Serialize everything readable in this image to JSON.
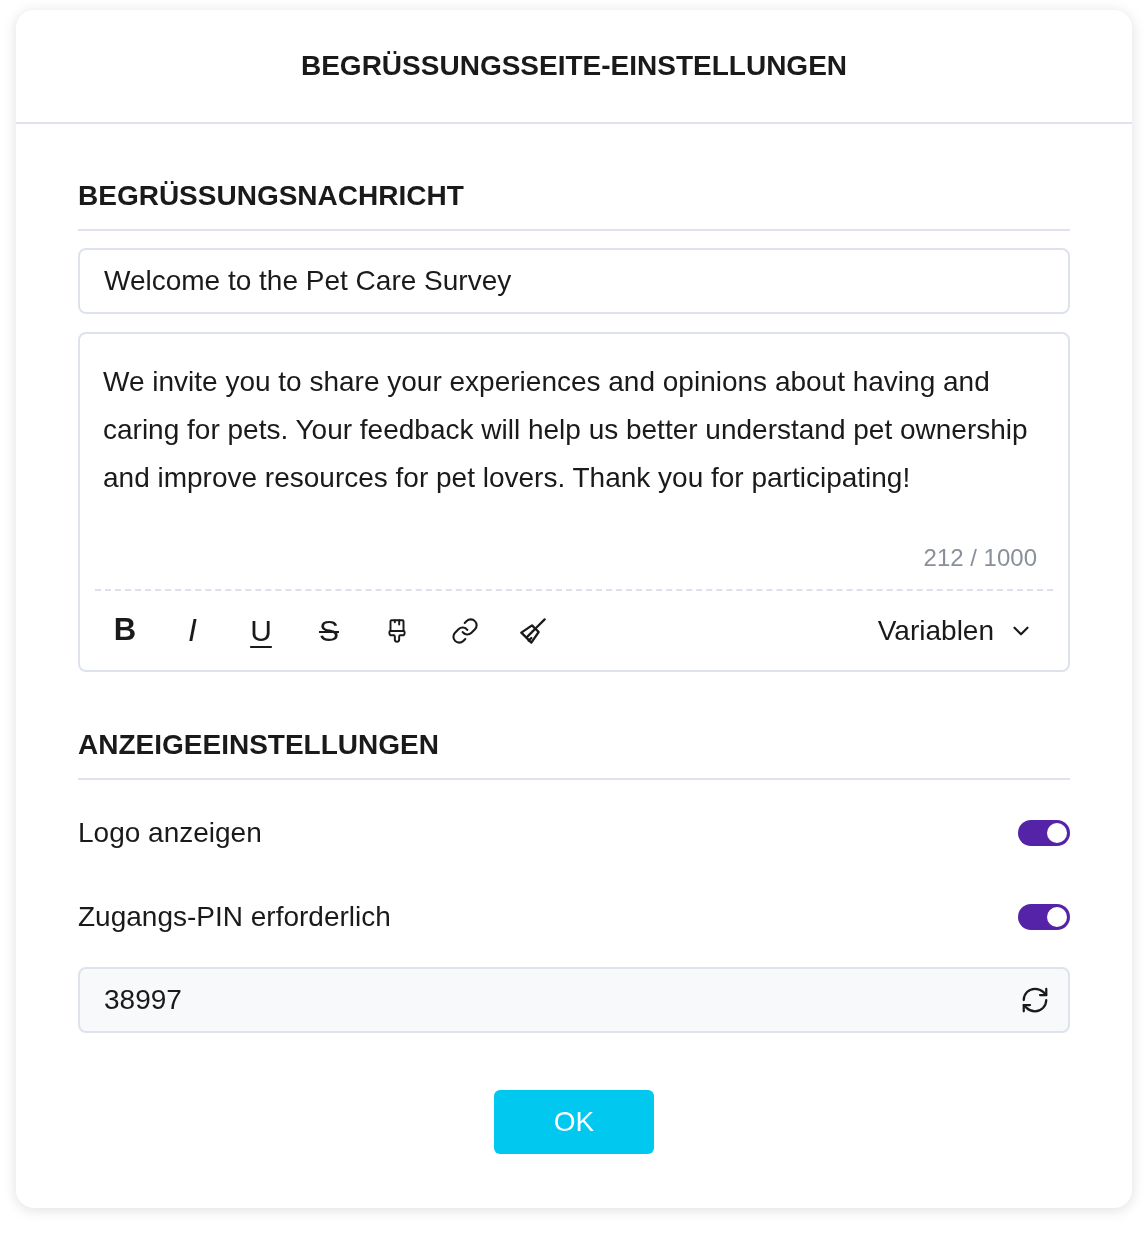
{
  "dialog": {
    "title": "BEGRÜSSUNGSSEITE-EINSTELLUNGEN"
  },
  "welcome_message": {
    "heading": "BEGRÜSSUNGSNACHRICHT",
    "title_field": {
      "value": "Welcome to the Pet Care Survey"
    },
    "body_field": {
      "value": "We invite you to share your experiences and opinions about having and caring for pets. Your feedback will help us better understand pet ownership and improve resources for pet lovers. Thank you for participating!",
      "counter": "212 / 1000"
    },
    "toolbar": {
      "tools": [
        {
          "kind": "bold",
          "label": "B"
        },
        {
          "kind": "italic",
          "label": "I"
        },
        {
          "kind": "underline",
          "label": "U"
        },
        {
          "kind": "strikethrough",
          "label": "S"
        },
        {
          "kind": "brush"
        },
        {
          "kind": "link"
        },
        {
          "kind": "clear"
        }
      ],
      "variables_menu": {
        "label": "Variablen"
      }
    }
  },
  "display_settings": {
    "heading": "ANZEIGEEINSTELLUNGEN",
    "toggles": [
      {
        "label": "Logo anzeigen",
        "on": true
      },
      {
        "label": "Zugangs-PIN erforderlich",
        "on": true
      }
    ],
    "pin_field": {
      "value": "38997"
    }
  },
  "buttons": [
    {
      "label": "OK"
    }
  ]
}
